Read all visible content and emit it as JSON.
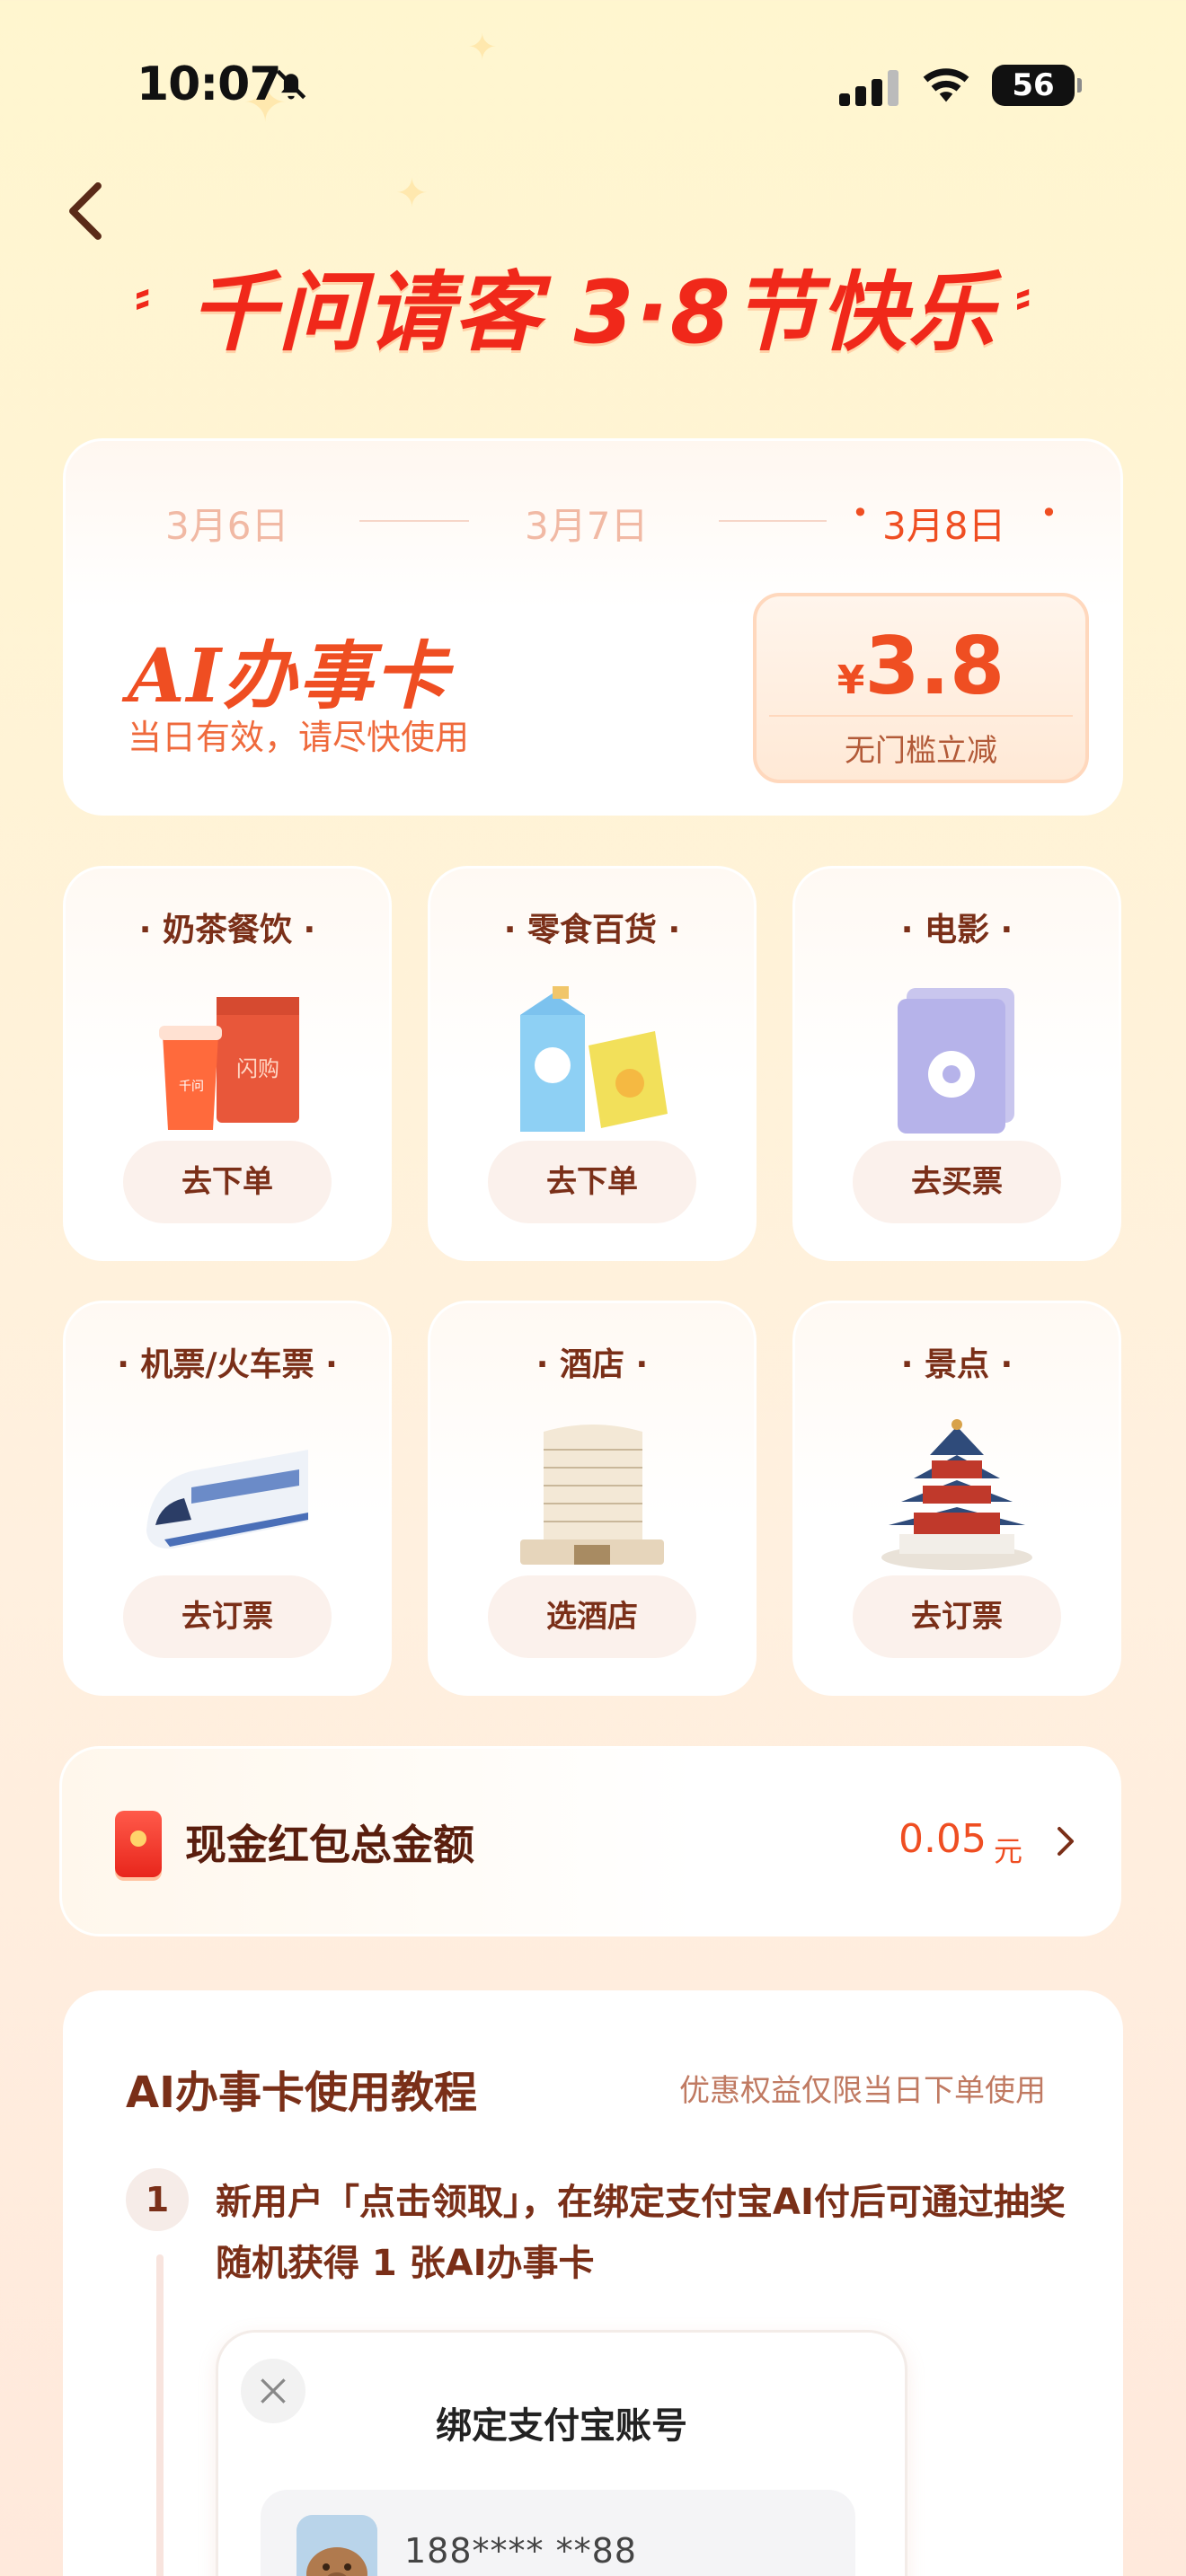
{
  "status_bar": {
    "time": "10:07",
    "battery": "56"
  },
  "header": {
    "title": "千问请客 3·8节快乐"
  },
  "ai_card": {
    "dates": [
      "3月6日",
      "3月7日",
      "3月8日"
    ],
    "active_date_index": 2,
    "title": "AI办事卡",
    "subtitle": "当日有效，请尽快使用",
    "coupon_currency": "¥",
    "coupon_amount": "3.8",
    "coupon_label": "无门槛立减"
  },
  "services": [
    {
      "title": "奶茶餐饮",
      "button": "去下单",
      "icon": "milk-tea-bag-icon"
    },
    {
      "title": "零食百货",
      "button": "去下单",
      "icon": "snacks-icon"
    },
    {
      "title": "电影",
      "button": "去买票",
      "icon": "movie-ticket-icon"
    },
    {
      "title": "机票/火车票",
      "button": "去订票",
      "icon": "train-icon"
    },
    {
      "title": "酒店",
      "button": "选酒店",
      "icon": "hotel-icon"
    },
    {
      "title": "景点",
      "button": "去订票",
      "icon": "temple-icon"
    }
  ],
  "red_packet": {
    "label": "现金红包总金额",
    "amount": "0.05",
    "unit": "元"
  },
  "tutorial": {
    "title": "AI办事卡使用教程",
    "note": "优惠权益仅限当日下单使用",
    "steps": [
      {
        "number": "1",
        "text": "新用户「点击领取」，在绑定支付宝AI付后可通过抽奖随机获得 1 张AI办事卡"
      }
    ],
    "dialog": {
      "title": "绑定支付宝账号",
      "account": "188**** **88"
    }
  },
  "colors": {
    "accent": "#ef4e22",
    "title_red": "#f0281a",
    "text_brown": "#7a2f18"
  }
}
